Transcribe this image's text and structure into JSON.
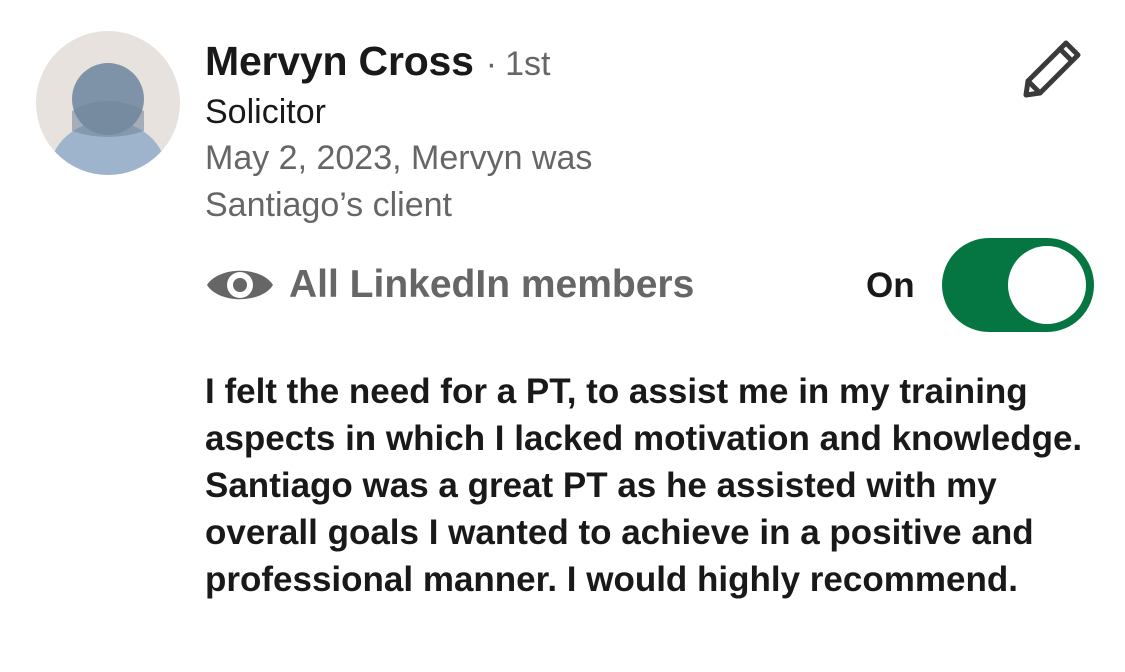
{
  "recommendation": {
    "author_name": "Mervyn Cross",
    "separator": "·",
    "connection_degree": "1st",
    "author_title": "Solicitor",
    "relation_text": "May 2, 2023, Mervyn was Santiago’s client",
    "body": "I felt the need for a PT, to assist me in my training aspects in which I lacked motivation and knowledge. Santiago was a great PT as he assisted with my overall goals I wanted to achieve in a positive and professional manner. I would highly recommend."
  },
  "visibility": {
    "icon": "eye-icon",
    "label": "All LinkedIn members",
    "toggle_label": "On",
    "toggle_state": "on"
  },
  "actions": {
    "edit_icon": "pencil-icon"
  },
  "colors": {
    "toggle_on": "#057642",
    "primary_text": "#191919",
    "secondary_text": "#666666",
    "avatar_bg": "#e7e2dd",
    "avatar_figure": "#9db4cc",
    "avatar_head": "#7f93a8"
  }
}
